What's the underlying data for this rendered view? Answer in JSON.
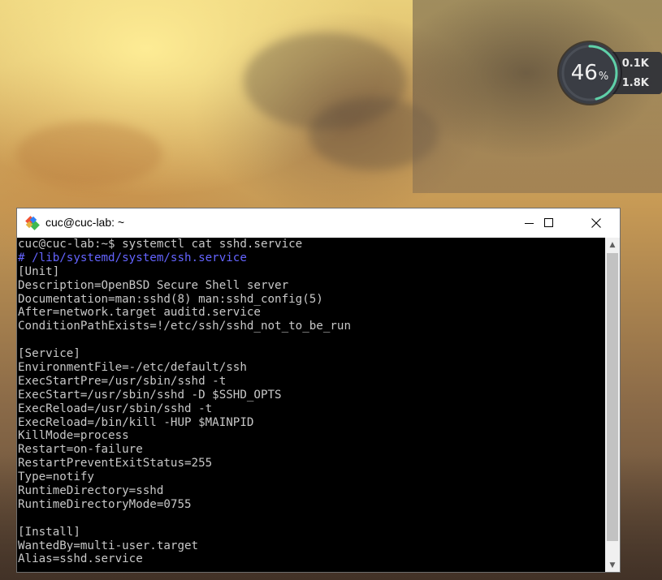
{
  "desktop": {
    "net_widget": {
      "cpu_percent_value": "46",
      "cpu_percent_unit": "%",
      "upload": "0.1K",
      "download": "1.8K",
      "gauge_fraction": 0.46,
      "colors": {
        "gauge_arc": "#5fd0a8",
        "up_arrow": "#3aa0ff",
        "down_arrow": "#3ddc84"
      }
    }
  },
  "window": {
    "title": "cuc@cuc-lab: ~",
    "icon": "git-bash-diamond-icon",
    "controls": [
      "minimize-icon",
      "maximize-icon",
      "close-icon"
    ]
  },
  "terminal": {
    "lines": [
      {
        "text": "cuc@cuc-lab:~$ systemctl cat sshd.service",
        "kind": "normal"
      },
      {
        "text": "# /lib/systemd/system/ssh.service",
        "kind": "comment"
      },
      {
        "text": "[Unit]",
        "kind": "normal"
      },
      {
        "text": "Description=OpenBSD Secure Shell server",
        "kind": "normal"
      },
      {
        "text": "Documentation=man:sshd(8) man:sshd_config(5)",
        "kind": "normal"
      },
      {
        "text": "After=network.target auditd.service",
        "kind": "normal"
      },
      {
        "text": "ConditionPathExists=!/etc/ssh/sshd_not_to_be_run",
        "kind": "normal"
      },
      {
        "text": "",
        "kind": "normal"
      },
      {
        "text": "[Service]",
        "kind": "normal"
      },
      {
        "text": "EnvironmentFile=-/etc/default/ssh",
        "kind": "normal"
      },
      {
        "text": "ExecStartPre=/usr/sbin/sshd -t",
        "kind": "normal"
      },
      {
        "text": "ExecStart=/usr/sbin/sshd -D $SSHD_OPTS",
        "kind": "normal"
      },
      {
        "text": "ExecReload=/usr/sbin/sshd -t",
        "kind": "normal"
      },
      {
        "text": "ExecReload=/bin/kill -HUP $MAINPID",
        "kind": "normal"
      },
      {
        "text": "KillMode=process",
        "kind": "normal"
      },
      {
        "text": "Restart=on-failure",
        "kind": "normal"
      },
      {
        "text": "RestartPreventExitStatus=255",
        "kind": "normal"
      },
      {
        "text": "Type=notify",
        "kind": "normal"
      },
      {
        "text": "RuntimeDirectory=sshd",
        "kind": "normal"
      },
      {
        "text": "RuntimeDirectoryMode=0755",
        "kind": "normal"
      },
      {
        "text": "",
        "kind": "normal"
      },
      {
        "text": "[Install]",
        "kind": "normal"
      },
      {
        "text": "WantedBy=multi-user.target",
        "kind": "normal"
      },
      {
        "text": "Alias=sshd.service",
        "kind": "normal"
      }
    ],
    "colors": {
      "background": "#000000",
      "foreground": "#c8c8c8",
      "comment": "#6464ff"
    }
  }
}
